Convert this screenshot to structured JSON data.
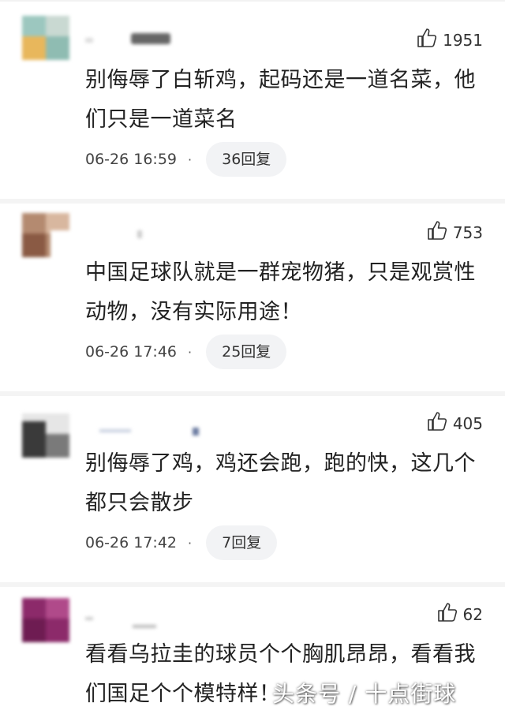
{
  "comments": [
    {
      "likes": "1951",
      "text": "别侮辱了白斩鸡，起码还是一道名菜，他们只是一道菜名",
      "time": "06-26 16:59",
      "replies": "36回复"
    },
    {
      "likes": "753",
      "text": "中国足球队就是一群宠物猪，只是观赏性动物，没有实际用途！",
      "time": "06-26 17:46",
      "replies": "25回复"
    },
    {
      "likes": "405",
      "text": "别侮辱了鸡，鸡还会跑，跑的快，这几个都只会散步",
      "time": "06-26 17:42",
      "replies": "7回复"
    },
    {
      "likes": "62",
      "text": "看看乌拉圭的球员个个胸肌昂昂，看看我们国足个个模特样！",
      "time": "",
      "replies": ""
    }
  ],
  "meta_separator": "·",
  "watermark": "头条号 / 十点街球",
  "icons": {
    "like": "thumbs-up-icon"
  },
  "colors": {
    "text": "#222222",
    "reply_bg": "#f2f3f5",
    "divider": "#f4f4f4"
  }
}
